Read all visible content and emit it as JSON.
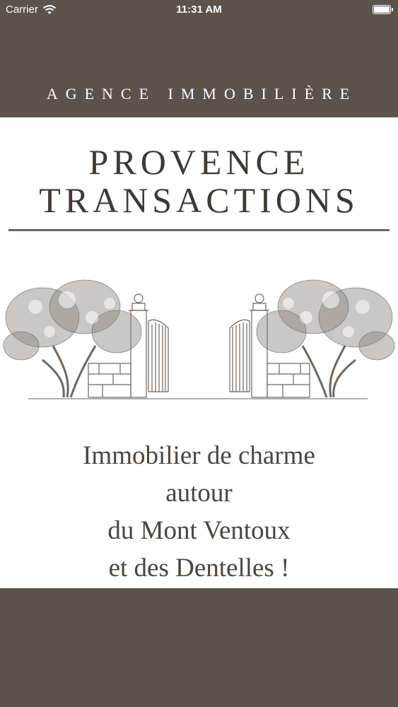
{
  "status_bar": {
    "carrier": "Carrier",
    "time": "11:31 AM",
    "battery_level": 1.0,
    "icons": [
      "wifi-icon",
      "battery-icon"
    ]
  },
  "header": {
    "agency_label": "AGENCE IMMOBILIÈRE"
  },
  "brand": {
    "line_1": "PROVENCE",
    "line_2": "TRANSACTIONS"
  },
  "illustration": {
    "icon": "olive-trees-and-gate-illustration"
  },
  "tagline": {
    "lines": [
      "Immobilier de charme",
      "autour",
      "du Mont Ventoux",
      "et des Dentelles !"
    ]
  },
  "colors": {
    "background": "#5b524c",
    "panel": "#ffffff",
    "brand_text": "#3f3935",
    "tagline_text": "#4a4541"
  }
}
